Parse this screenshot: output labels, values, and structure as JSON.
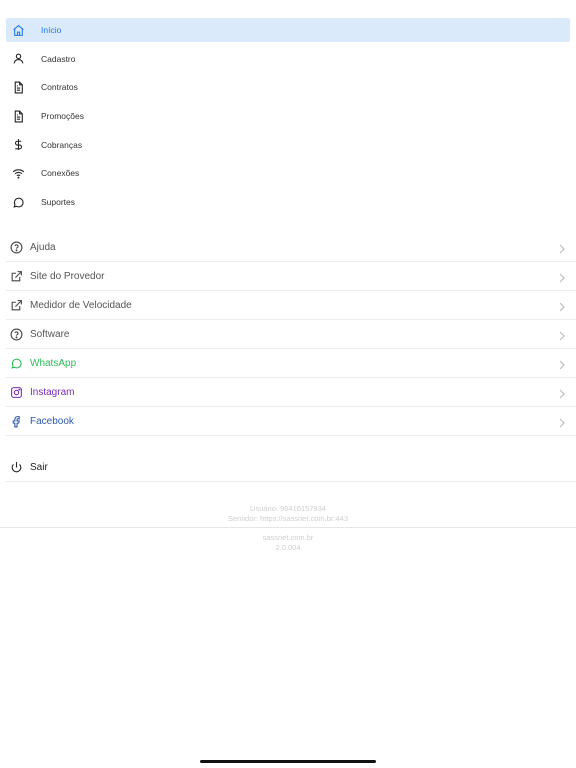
{
  "menu": {
    "items": [
      {
        "label": "Início",
        "icon": "home-icon",
        "active": true
      },
      {
        "label": "Cadastro",
        "icon": "user-icon"
      },
      {
        "label": "Contratos",
        "icon": "document-icon"
      },
      {
        "label": "Promoções",
        "icon": "document-icon"
      },
      {
        "label": "Cobranças",
        "icon": "dollar-icon"
      },
      {
        "label": "Conexões",
        "icon": "wifi-icon"
      },
      {
        "label": "Suportes",
        "icon": "chat-icon"
      }
    ]
  },
  "links": {
    "items": [
      {
        "label": "Ajuda",
        "icon": "help-icon"
      },
      {
        "label": "Site do Provedor",
        "icon": "external-link-icon"
      },
      {
        "label": "Medidor de Velocidade",
        "icon": "external-link-icon"
      },
      {
        "label": "Software",
        "icon": "help-icon"
      },
      {
        "label": "WhatsApp",
        "icon": "whatsapp-icon",
        "color": "#2ebd59"
      },
      {
        "label": "Instagram",
        "icon": "instagram-icon",
        "color": "#7a2bb3"
      },
      {
        "label": "Facebook",
        "icon": "facebook-icon",
        "color": "#2f5aa8"
      }
    ]
  },
  "logout": {
    "label": "Sair",
    "icon": "power-icon"
  },
  "footer": {
    "user": "Usuário: 96416157934",
    "server": "Servidor: https://sassnet.com.br:443",
    "site": "sassnet.com.br",
    "version": "2.0.004"
  },
  "colors": {
    "accent": "#1f7ae0",
    "active_bg": "#dbeafb"
  }
}
